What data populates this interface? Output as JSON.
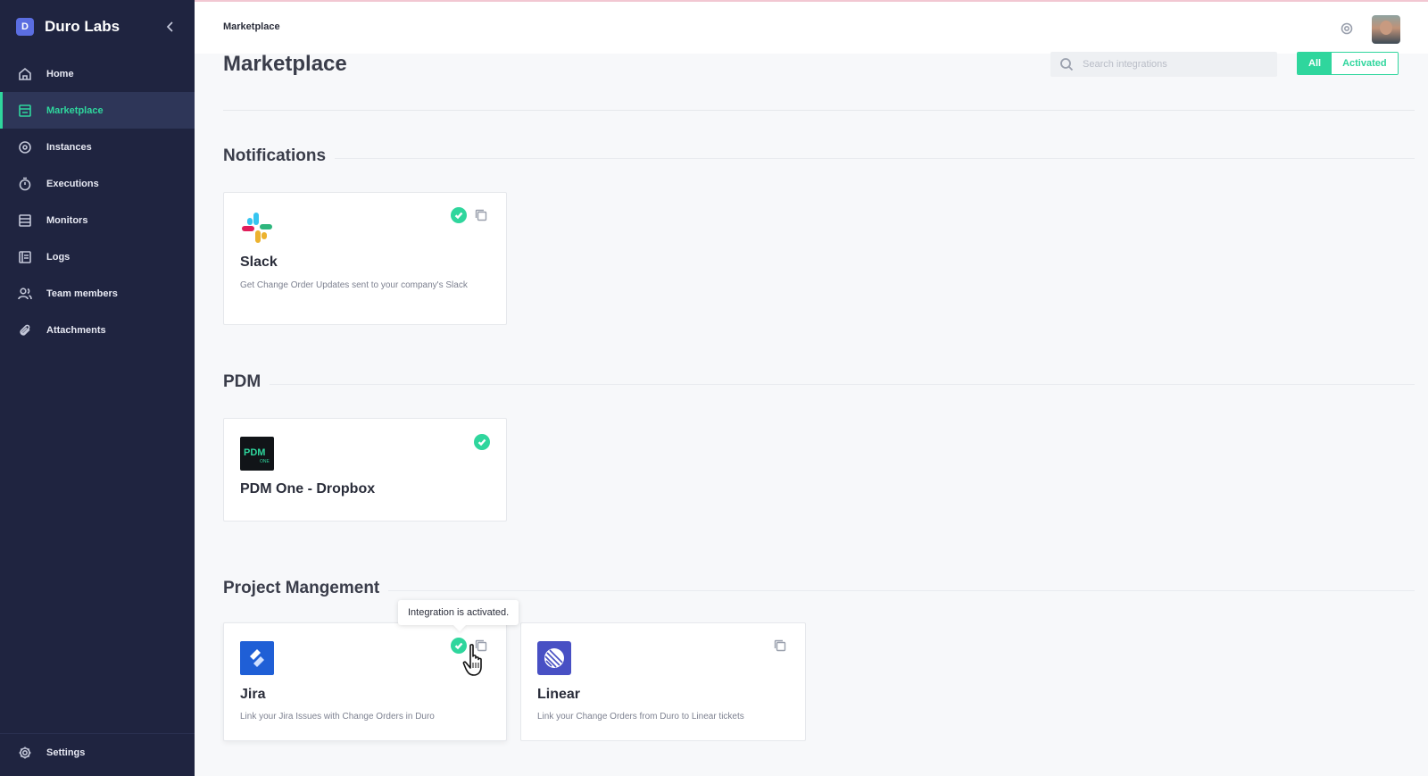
{
  "brand": {
    "name": "Duro Labs",
    "logo_letter": "D"
  },
  "sidebar": {
    "items": [
      {
        "label": "Home",
        "icon": "home-icon"
      },
      {
        "label": "Marketplace",
        "icon": "store-icon",
        "active": true
      },
      {
        "label": "Instances",
        "icon": "instances-icon"
      },
      {
        "label": "Executions",
        "icon": "stopwatch-icon"
      },
      {
        "label": "Monitors",
        "icon": "monitor-icon"
      },
      {
        "label": "Logs",
        "icon": "logs-icon"
      },
      {
        "label": "Team members",
        "icon": "users-icon"
      },
      {
        "label": "Attachments",
        "icon": "paperclip-icon"
      }
    ],
    "settings": {
      "label": "Settings",
      "icon": "gear-icon"
    }
  },
  "topbar": {
    "title": "Marketplace"
  },
  "main": {
    "title": "Marketplace",
    "search": {
      "placeholder": "Search integrations"
    },
    "filters": {
      "all": "All",
      "activated": "Activated",
      "selected": "All"
    },
    "sections": [
      {
        "title": "Notifications",
        "cards": [
          {
            "name": "Slack",
            "description": "Get Change Order Updates sent to your company's Slack",
            "activated": true,
            "logo": "slack-logo"
          }
        ]
      },
      {
        "title": "PDM",
        "cards": [
          {
            "name": "PDM One - Dropbox",
            "description": "",
            "activated": true,
            "logo": "pdm-one-logo",
            "logo_text": "PDM",
            "logo_subtext": "ONE"
          }
        ]
      },
      {
        "title": "Project Mangement",
        "cards": [
          {
            "name": "Jira",
            "description": "Link your Jira Issues with Change Orders in Duro",
            "activated": true,
            "logo": "jira-logo"
          },
          {
            "name": "Linear",
            "description": "Link your Change Orders from Duro to Linear tickets",
            "activated": false,
            "logo": "linear-logo"
          }
        ]
      }
    ],
    "tooltip": "Integration is activated."
  },
  "colors": {
    "sidebar_bg": "#1f2440",
    "accent": "#2fd69d",
    "page_bg": "#f7f8fa"
  }
}
